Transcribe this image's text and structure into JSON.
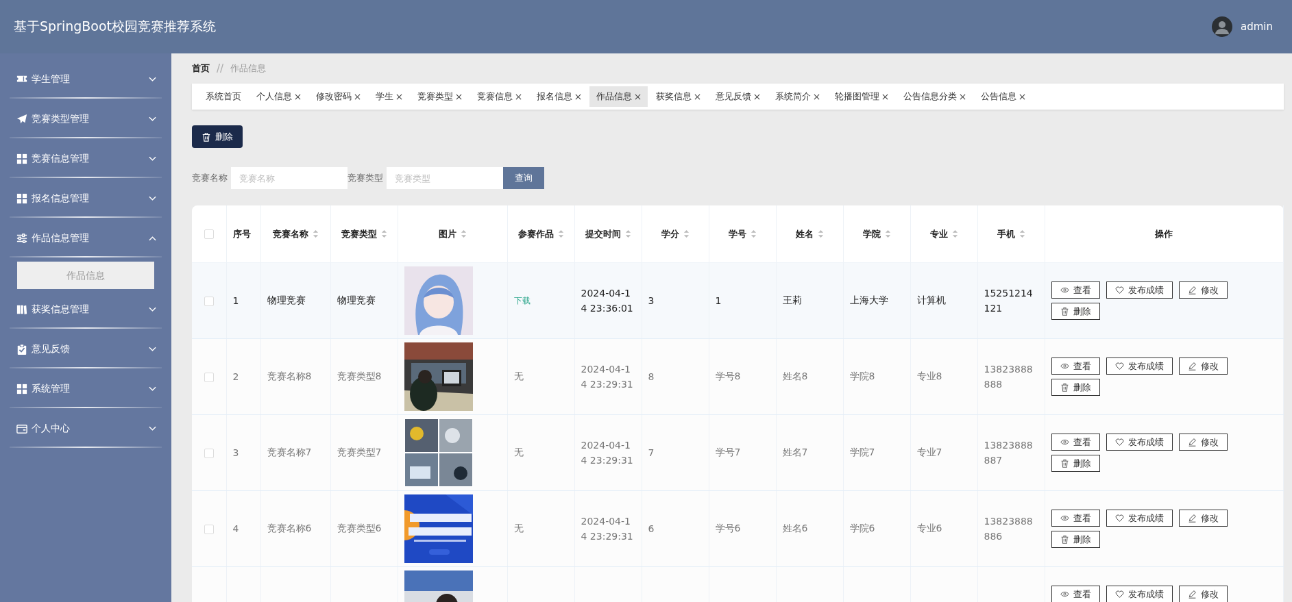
{
  "header": {
    "title": "基于SpringBoot校园竞赛推荐系统",
    "user": "admin"
  },
  "sidebar": {
    "items": [
      {
        "label": "学生管理",
        "kind": "ticket",
        "expanded": false
      },
      {
        "label": "竞赛类型管理",
        "kind": "plane",
        "expanded": false
      },
      {
        "label": "竞赛信息管理",
        "kind": "grid",
        "expanded": false
      },
      {
        "label": "报名信息管理",
        "kind": "grid",
        "expanded": false
      },
      {
        "label": "作品信息管理",
        "kind": "sliders",
        "expanded": true,
        "children": [
          {
            "label": "作品信息",
            "selected": true
          }
        ]
      },
      {
        "label": "获奖信息管理",
        "kind": "book",
        "expanded": false
      },
      {
        "label": "意见反馈",
        "kind": "clipboard",
        "expanded": false
      },
      {
        "label": "系统管理",
        "kind": "grid",
        "expanded": false
      },
      {
        "label": "个人中心",
        "kind": "card",
        "expanded": false
      }
    ]
  },
  "breadcrumb": {
    "items": [
      {
        "label": "首页",
        "current": false
      },
      {
        "label": "作品信息",
        "current": true
      }
    ],
    "separator": "//"
  },
  "tabs": [
    {
      "label": "系统首页",
      "closable": false,
      "selected": false
    },
    {
      "label": "个人信息",
      "closable": true,
      "selected": false
    },
    {
      "label": "修改密码",
      "closable": true,
      "selected": false
    },
    {
      "label": "学生",
      "closable": true,
      "selected": false
    },
    {
      "label": "竞赛类型",
      "closable": true,
      "selected": false
    },
    {
      "label": "竞赛信息",
      "closable": true,
      "selected": false
    },
    {
      "label": "报名信息",
      "closable": true,
      "selected": false
    },
    {
      "label": "作品信息",
      "closable": true,
      "selected": true
    },
    {
      "label": "获奖信息",
      "closable": true,
      "selected": false
    },
    {
      "label": "意见反馈",
      "closable": true,
      "selected": false
    },
    {
      "label": "系统简介",
      "closable": true,
      "selected": false
    },
    {
      "label": "轮播图管理",
      "closable": true,
      "selected": false
    },
    {
      "label": "公告信息分类",
      "closable": true,
      "selected": false
    },
    {
      "label": "公告信息",
      "closable": true,
      "selected": false
    }
  ],
  "toolbar": {
    "delete_button": "删除"
  },
  "search": {
    "fields": [
      {
        "label": "竞赛名称",
        "placeholder": "竞赛名称"
      },
      {
        "label": "竞赛类型",
        "placeholder": "竞赛类型"
      }
    ],
    "button": "查询"
  },
  "table": {
    "select_all_checked": false,
    "columns": [
      {
        "label": "序号",
        "sortable": false
      },
      {
        "label": "竞赛名称",
        "sortable": true
      },
      {
        "label": "竞赛类型",
        "sortable": true
      },
      {
        "label": "图片",
        "sortable": true
      },
      {
        "label": "参赛作品",
        "sortable": true
      },
      {
        "label": "提交时间",
        "sortable": true
      },
      {
        "label": "学分",
        "sortable": true
      },
      {
        "label": "学号",
        "sortable": true
      },
      {
        "label": "姓名",
        "sortable": true
      },
      {
        "label": "学院",
        "sortable": true
      },
      {
        "label": "专业",
        "sortable": true
      },
      {
        "label": "手机",
        "sortable": true
      },
      {
        "label": "操作",
        "sortable": false
      }
    ],
    "rows": [
      {
        "checked": false,
        "hovered": true,
        "picture": {
          "kind": "picture"
        },
        "cells": [
          "1",
          "物理竞赛",
          "物理竞赛",
          null,
          {
            "text": "下载",
            "kind": "link"
          },
          "2024-04-14 23:36:01",
          "3",
          "1",
          "王莉",
          "上海大学",
          "计算机",
          "15251214121"
        ],
        "actions": [
          {
            "label": "查看",
            "kind": "view"
          },
          {
            "label": "发布成绩",
            "kind": "grade"
          },
          {
            "label": "修改",
            "kind": "edit"
          },
          {
            "label": "删除",
            "kind": "delete"
          }
        ]
      },
      {
        "checked": false,
        "hovered": false,
        "picture": {
          "kind": "picture"
        },
        "cells": [
          "2",
          "竞赛名称8",
          "竞赛类型8",
          null,
          {
            "text": "无",
            "kind": "text"
          },
          "2024-04-14 23:29:31",
          "8",
          "学号8",
          "姓名8",
          "学院8",
          "专业8",
          "13823888888"
        ],
        "actions": [
          {
            "label": "查看",
            "kind": "view"
          },
          {
            "label": "发布成绩",
            "kind": "grade"
          },
          {
            "label": "修改",
            "kind": "edit"
          },
          {
            "label": "删除",
            "kind": "delete"
          }
        ]
      },
      {
        "checked": false,
        "hovered": false,
        "picture": {
          "kind": "picture"
        },
        "cells": [
          "3",
          "竞赛名称7",
          "竞赛类型7",
          null,
          {
            "text": "无",
            "kind": "text"
          },
          "2024-04-14 23:29:31",
          "7",
          "学号7",
          "姓名7",
          "学院7",
          "专业7",
          "13823888887"
        ],
        "actions": [
          {
            "label": "查看",
            "kind": "view"
          },
          {
            "label": "发布成绩",
            "kind": "grade"
          },
          {
            "label": "修改",
            "kind": "edit"
          },
          {
            "label": "删除",
            "kind": "delete"
          }
        ]
      },
      {
        "checked": false,
        "hovered": false,
        "picture": {
          "kind": "picture"
        },
        "cells": [
          "4",
          "竞赛名称6",
          "竞赛类型6",
          null,
          {
            "text": "无",
            "kind": "text"
          },
          "2024-04-14 23:29:31",
          "6",
          "学号6",
          "姓名6",
          "学院6",
          "专业6",
          "13823888886"
        ],
        "actions": [
          {
            "label": "查看",
            "kind": "view"
          },
          {
            "label": "发布成绩",
            "kind": "grade"
          },
          {
            "label": "修改",
            "kind": "edit"
          },
          {
            "label": "删除",
            "kind": "delete"
          }
        ]
      },
      {
        "picture": {
          "kind": "picture"
        },
        "cells": [
          null,
          null,
          null,
          null,
          null,
          null,
          null,
          null,
          null,
          null,
          null,
          null
        ],
        "actions": [
          {
            "label": "查看",
            "kind": "view"
          },
          {
            "label": "发布成绩",
            "kind": "grade"
          },
          {
            "label": "修改",
            "kind": "edit"
          }
        ]
      }
    ]
  }
}
